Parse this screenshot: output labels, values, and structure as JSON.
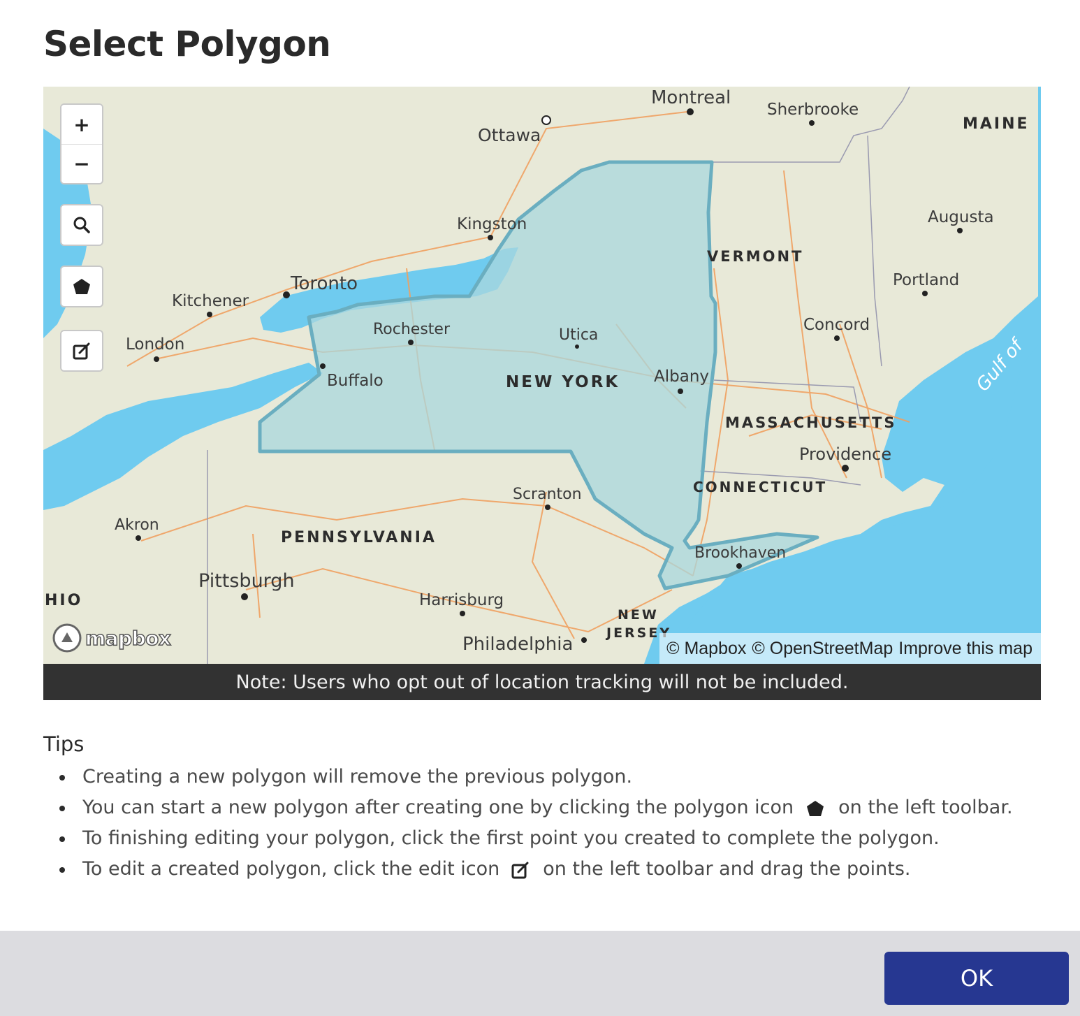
{
  "dialog": {
    "title": "Select Polygon"
  },
  "map": {
    "provider_logo": "mapbox",
    "attribution": {
      "mapbox": "© Mapbox",
      "osm": "© OpenStreetMap",
      "improve": "Improve this map"
    },
    "controls": {
      "zoom_in": "+",
      "zoom_out": "−",
      "search_icon": "search-icon",
      "polygon_icon": "polygon-icon",
      "edit_icon": "edit-icon"
    },
    "place_labels": {
      "montreal": "Montreal",
      "sherbrooke": "Sherbrooke",
      "ottawa": "Ottawa",
      "kingston": "Kingston",
      "augusta": "Augusta",
      "portland": "Portland",
      "toronto": "Toronto",
      "kitchener": "Kitchener",
      "london": "London",
      "rochester": "Rochester",
      "utica": "Utica",
      "albany": "Albany",
      "concord": "Concord",
      "buffalo": "Buffalo",
      "providence": "Providence",
      "scranton": "Scranton",
      "akron": "Akron",
      "brookhaven": "Brookhaven",
      "pittsburgh": "Pittsburgh",
      "harrisburg": "Harrisburg",
      "philadelphia": "Philadelphia",
      "gulf": "Gulf of"
    },
    "state_labels": {
      "maine": "MAINE",
      "vermont": "VERMONT",
      "new_york": "NEW YORK",
      "massachusetts": "MASSACHUSETTS",
      "connecticut": "CONNECTICUT",
      "pennsylvania": "PENNSYLVANIA",
      "ohio": "HIO",
      "new_jersey_1": "NEW",
      "new_jersey_2": "JERSEY"
    },
    "colors": {
      "water": "#6fcbef",
      "land": "#e8e9d8",
      "polygon_fill": "#a9d7dd",
      "polygon_stroke": "#6aaec0",
      "roads": "#f0a060"
    }
  },
  "note": "Note: Users who opt out of location tracking will not be included.",
  "tips": {
    "heading": "Tips",
    "items": [
      {
        "text": "Creating a new polygon will remove the previous polygon."
      },
      {
        "before": "You can start a new polygon after creating one by clicking the polygon icon",
        "after": "on the left toolbar."
      },
      {
        "text": "To finishing editing your polygon, click the first point you created to complete the polygon."
      },
      {
        "before": "To edit a created polygon, click the edit icon",
        "after": "on the left toolbar and drag the points."
      }
    ]
  },
  "footer": {
    "ok_label": "OK"
  },
  "colors": {
    "primary_button": "#263791",
    "note_bar": "#323232",
    "footer_bg": "#dcdce0"
  }
}
